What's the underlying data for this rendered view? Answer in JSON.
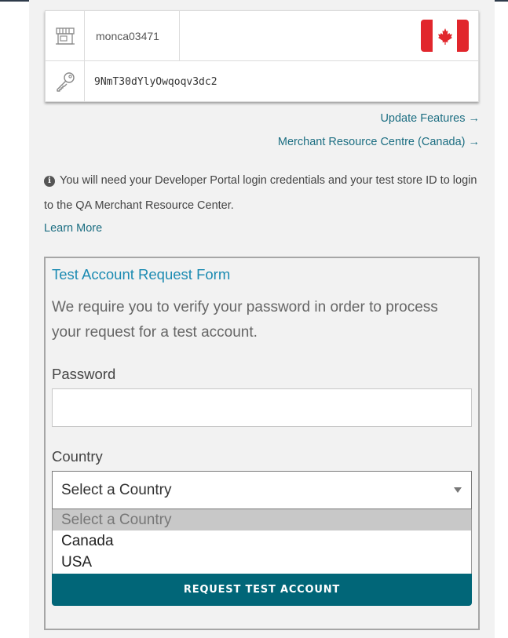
{
  "credentials": {
    "store_id": "monca03471",
    "api_token": "9NmT30dYlyOwqoqv3dc2",
    "store_icon": "store-icon",
    "key_icon": "key-icon",
    "country_flag": "canada-flag"
  },
  "links": {
    "update_features": "Update Features →",
    "merchant_resource": "Merchant Resource Centre (Canada) →"
  },
  "info": {
    "text": "You will need your Developer Portal login credentials and your test store ID to login to the QA Merchant Resource Center.",
    "learn_more": "Learn More"
  },
  "form": {
    "title": "Test Account Request Form",
    "description": "We require you to verify your password in order to process your request for a test account.",
    "password_label": "Password",
    "password_value": "",
    "country_label": "Country",
    "country_selected": "Select a Country",
    "country_options": [
      "Select a Country",
      "Canada",
      "USA"
    ],
    "submit_label": "REQUEST TEST ACCOUNT"
  },
  "colors": {
    "accent": "#016678",
    "link": "#1c6e82",
    "title": "#1c8bb2",
    "flag_red": "#e1262c"
  }
}
